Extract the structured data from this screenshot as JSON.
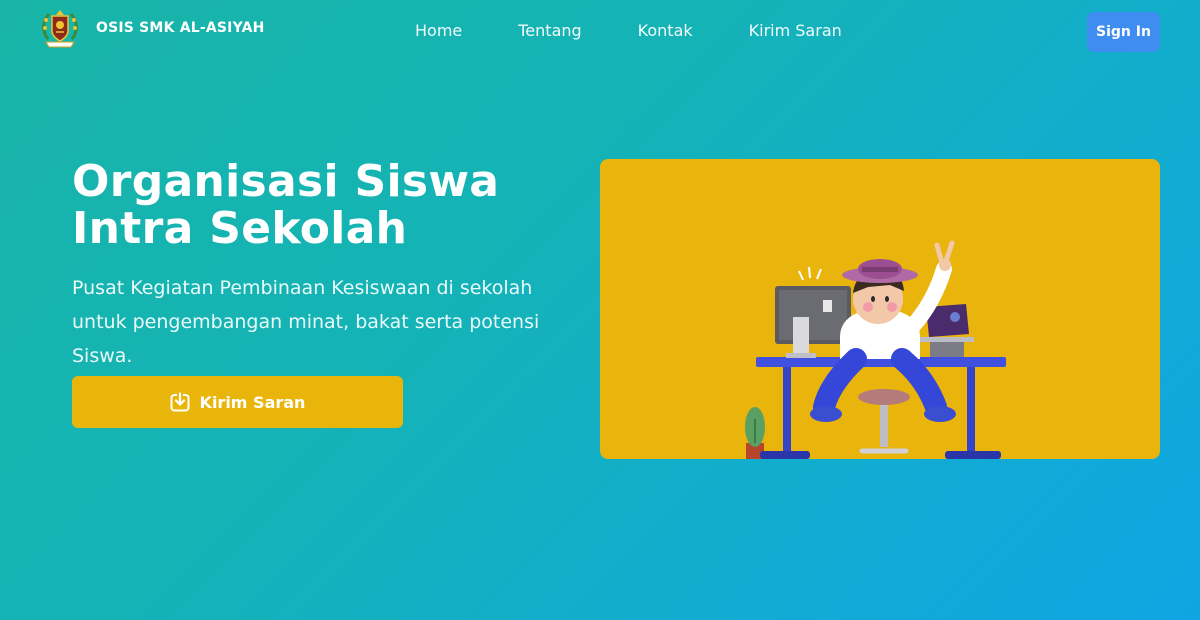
{
  "brand": {
    "name": "OSIS SMK AL-ASIYAH",
    "logo_icon": "school-emblem-icon"
  },
  "nav": {
    "items": [
      {
        "label": "Home"
      },
      {
        "label": "Tentang"
      },
      {
        "label": "Kontak"
      },
      {
        "label": "Kirim Saran"
      }
    ],
    "signin_label": "Sign In"
  },
  "hero": {
    "title_line1": "Organisasi Siswa",
    "title_line2": "Intra Sekolah",
    "description": "Pusat Kegiatan Pembinaan Kesiswaan di sekolah untuk pengembangan minat, bakat serta potensi Siswa.",
    "cta_label": "Kirim Saran",
    "cta_icon": "download-icon",
    "image": "person-at-desk-illustration"
  },
  "colors": {
    "accent_yellow": "#e9b50a",
    "signin_blue": "#3f8df0",
    "gradient_start": "#19b5a8",
    "gradient_end": "#0fa5e3"
  }
}
